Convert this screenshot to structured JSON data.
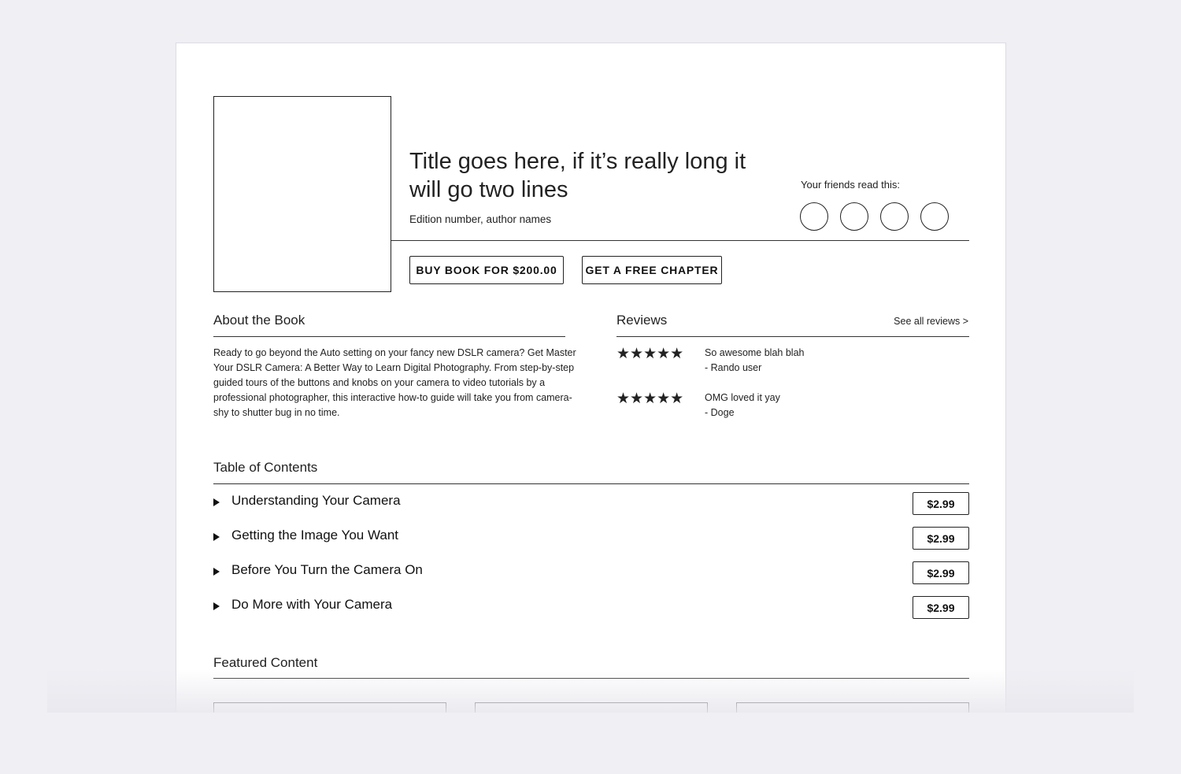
{
  "product": {
    "title": "Title goes here, if it’s really long it will go two lines",
    "edition": "Edition number, author names",
    "friends_label": "Your friends read this:",
    "buy_label": "BUY BOOK FOR $200.00",
    "free_chapter_label": "GET A FREE CHAPTER"
  },
  "about": {
    "heading": "About the Book",
    "text": "Ready to go beyond the Auto setting on your fancy new DSLR camera? Get Master Your DSLR Camera: A Better Way to Learn Digital Photography. From step-by-step guided tours of the buttons and knobs on your camera to video tutorials by a professional photographer, this interactive how-to guide will take you from camera-shy to shutter bug in no time."
  },
  "reviews": {
    "heading": "Reviews",
    "see_all": "See all reviews >",
    "items": [
      {
        "stars": "★★★★★",
        "rating": 5,
        "text": "So awesome blah blah",
        "author": "- Rando user"
      },
      {
        "stars": "★★★★★",
        "rating": 5,
        "text": "OMG loved it yay",
        "author": "- Doge"
      }
    ]
  },
  "toc": {
    "heading": "Table of Contents",
    "items": [
      {
        "label": "Understanding Your Camera",
        "price": "$2.99"
      },
      {
        "label": "Getting the Image You Want",
        "price": "$2.99"
      },
      {
        "label": "Before You Turn the Camera On",
        "price": "$2.99"
      },
      {
        "label": "Do More with Your Camera",
        "price": "$2.99"
      }
    ]
  },
  "featured": {
    "heading": "Featured Content"
  },
  "icons": {
    "toc_expand": "triangle-right-icon",
    "star": "star-icon"
  },
  "colors": {
    "background": "#efeff4",
    "page": "#ffffff",
    "ink": "#222222"
  }
}
